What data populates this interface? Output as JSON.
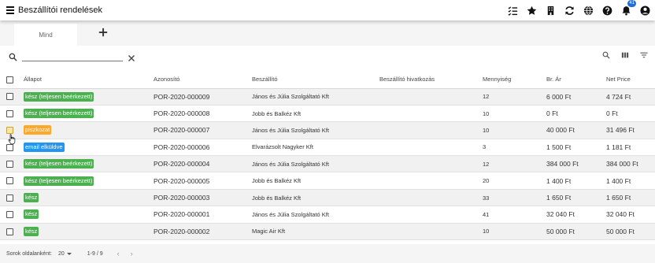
{
  "app": {
    "title": "Beszállítói rendelések",
    "notification_count": "41",
    "toolbar_icons": [
      "checklist-icon",
      "star-icon",
      "building-icon",
      "refresh-icon",
      "globe-icon",
      "help-icon",
      "bell-icon",
      "account-icon"
    ]
  },
  "tabs": {
    "items": [
      {
        "label": "Mind"
      }
    ],
    "add_icon": "plus-icon"
  },
  "search": {
    "value": "",
    "placeholder": ""
  },
  "table": {
    "columns": [
      "Állapot",
      "Azonosító",
      "Beszállító",
      "Beszállító hivatkozás",
      "Mennyiség",
      "Br. Ár",
      "Net Price"
    ],
    "rows": [
      {
        "status": "kész (teljesen beérkezett)",
        "status_color": "#4caf50",
        "id": "POR-2020-000009",
        "supplier": "János és Júlia Szolgáltató Kft",
        "ref": "",
        "qty": "12",
        "gross": "6 000 Ft",
        "net": "4 724 Ft"
      },
      {
        "status": "kész (teljesen beérkezett)",
        "status_color": "#4caf50",
        "id": "POR-2020-000008",
        "supplier": "Jobb és Balkéz Kft",
        "ref": "",
        "qty": "10",
        "gross": "0 Ft",
        "net": "0 Ft"
      },
      {
        "status": "piszkozat",
        "status_color": "#ffa726",
        "id": "POR-2020-000007",
        "supplier": "János és Júlia Szolgáltató Kft",
        "ref": "",
        "qty": "10",
        "gross": "40 000 Ft",
        "net": "31 496 Ft"
      },
      {
        "status": "email elküldve",
        "status_color": "#2196f3",
        "id": "POR-2020-000006",
        "supplier": "Elvarázsolt Nagyker Kft",
        "ref": "",
        "qty": "3",
        "gross": "1 500 Ft",
        "net": "1 181 Ft"
      },
      {
        "status": "kész (teljesen beérkezett)",
        "status_color": "#4caf50",
        "id": "POR-2020-000004",
        "supplier": "János és Júlia Szolgáltató Kft",
        "ref": "",
        "qty": "12",
        "gross": "384 000 Ft",
        "net": "384 000 Ft"
      },
      {
        "status": "kész (teljesen beérkezett)",
        "status_color": "#4caf50",
        "id": "POR-2020-000005",
        "supplier": "Jobb és Balkéz Kft",
        "ref": "",
        "qty": "20",
        "gross": "1 400 Ft",
        "net": "1 400 Ft"
      },
      {
        "status": "kész",
        "status_color": "#4caf50",
        "id": "POR-2020-000003",
        "supplier": "Jobb és Balkéz Kft",
        "ref": "",
        "qty": "33",
        "gross": "1 650 Ft",
        "net": "1 650 Ft"
      },
      {
        "status": "kész",
        "status_color": "#4caf50",
        "id": "POR-2020-000001",
        "supplier": "János és Júlia Szolgáltató Kft",
        "ref": "",
        "qty": "41",
        "gross": "32 040 Ft",
        "net": "32 040 Ft"
      },
      {
        "status": "kész",
        "status_color": "#4caf50",
        "id": "POR-2020-000002",
        "supplier": "Magic Air Kft",
        "ref": "",
        "qty": "10",
        "gross": "50 000 Ft",
        "net": "50 000 Ft"
      }
    ]
  },
  "footer": {
    "rows_per_page_label": "Sorok oldalanként:",
    "rows_per_page_value": "20",
    "range": "1-9 / 9",
    "prev_icon": "chevron-left-icon",
    "next_icon": "chevron-right-icon"
  }
}
